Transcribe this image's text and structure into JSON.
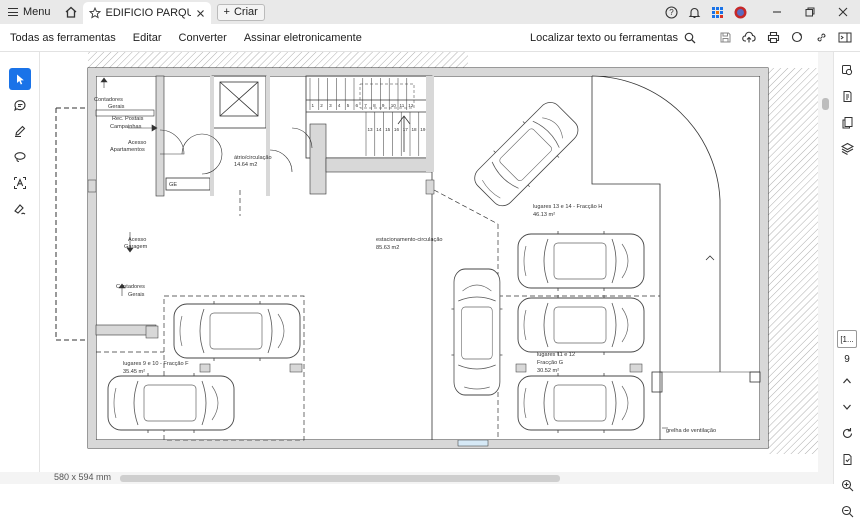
{
  "window": {
    "menu_label": "Menu",
    "tab_title": "EDIFICIO PARQUE ...",
    "new_tab_label": "Criar"
  },
  "toolbar": {
    "items": [
      "Todas as ferramentas",
      "Editar",
      "Converter",
      "Assinar eletronicamente"
    ],
    "search_label": "Localizar texto ou ferramentas"
  },
  "right_rail": {
    "page_box": "[1...",
    "page_number": "9"
  },
  "status": {
    "page_size": "580 x 594 mm"
  },
  "floorplan": {
    "labels": {
      "contadores_top": [
        "Contadores",
        "Gerais"
      ],
      "rec_postais": [
        "Rec. Postais",
        "Campainhas"
      ],
      "acesso_apart": [
        "Acesso",
        "Apartamentos"
      ],
      "atrio": [
        "átrio/circulação",
        "14.64 m2"
      ],
      "ge": "GE",
      "acesso_garagem": [
        "Acesso",
        "Garagem"
      ],
      "contadores_bottom": [
        "Contadores",
        "Gerais"
      ],
      "estacionamento": [
        "estacionamento-circulação",
        "85.63 m2"
      ],
      "fracao_h": [
        "lugares 13 e 14 - Fracção H",
        "46.13 m²"
      ],
      "fracao_f": [
        "lugares 9 e 10 - Fracção F",
        "35.45 m²"
      ],
      "fracao_g": [
        "lugares 11 e 12",
        "Fracção G",
        "30.52 m²"
      ],
      "grelha": "grelha de ventilação",
      "stair_numbers": [
        "1",
        "2",
        "3",
        "4",
        "5",
        "6",
        "7",
        "8",
        "9",
        "10",
        "11",
        "12",
        "13",
        "14",
        "15",
        "16",
        "17",
        "18",
        "19"
      ]
    }
  }
}
